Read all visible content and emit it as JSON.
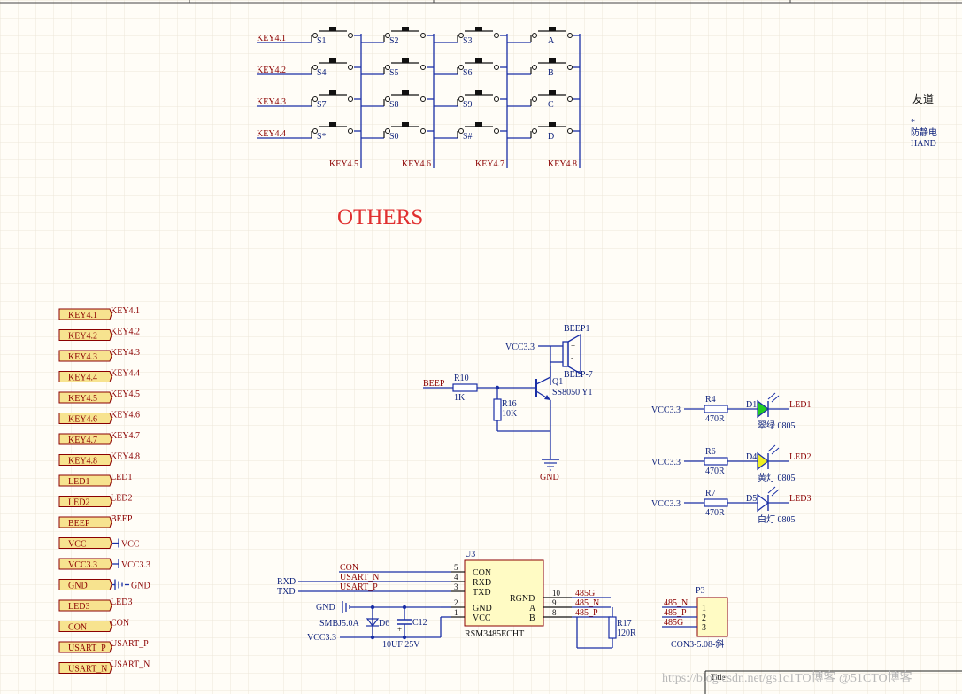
{
  "others_title": "OTHERS",
  "side_note": {
    "line1": "友道",
    "line2": "*",
    "line3": "防静电",
    "line4": "HAND"
  },
  "keypad": {
    "row_nets": [
      "KEY4.1",
      "KEY4.2",
      "KEY4.3",
      "KEY4.4"
    ],
    "col_nets": [
      "KEY4.5",
      "KEY4.6",
      "KEY4.7",
      "KEY4.8"
    ],
    "keys": [
      [
        "S1",
        "S2",
        "S3",
        "A"
      ],
      [
        "S4",
        "S5",
        "S6",
        "B"
      ],
      [
        "S7",
        "S8",
        "S9",
        "C"
      ],
      [
        "S*",
        "S0",
        "S#",
        "D"
      ]
    ]
  },
  "ports": [
    {
      "label": "KEY4.1",
      "net": "KEY4.1"
    },
    {
      "label": "KEY4.2",
      "net": "KEY4.2"
    },
    {
      "label": "KEY4.3",
      "net": "KEY4.3"
    },
    {
      "label": "KEY4.4",
      "net": "KEY4.4"
    },
    {
      "label": "KEY4.5",
      "net": "KEY4.5"
    },
    {
      "label": "KEY4.6",
      "net": "KEY4.6"
    },
    {
      "label": "KEY4.7",
      "net": "KEY4.7"
    },
    {
      "label": "KEY4.8",
      "net": "KEY4.8"
    },
    {
      "label": "LED1",
      "net": "LED1"
    },
    {
      "label": "LED2",
      "net": "LED2"
    },
    {
      "label": "BEEP",
      "net": "BEEP"
    },
    {
      "label": "VCC",
      "net": "VCC"
    },
    {
      "label": "VCC3.3",
      "net": "VCC3.3"
    },
    {
      "label": "GND",
      "net": "GND"
    },
    {
      "label": "LED3",
      "net": "LED3"
    },
    {
      "label": "CON",
      "net": "CON"
    },
    {
      "label": "USART_P",
      "net": "USART_P"
    },
    {
      "label": "USART_N",
      "net": "USART_N"
    }
  ],
  "beeper": {
    "vcc": "VCC3.3",
    "beep_ref": "BEEP1",
    "beep_val": "BEEP-7",
    "plus": "+",
    "minus": "-",
    "net": "BEEP",
    "r10_ref": "R10",
    "r10_val": "1K",
    "r16_ref": "R16",
    "r16_val": "10K",
    "q_ref": "Q1",
    "q_val": "SS8050 Y1",
    "gnd": "GND"
  },
  "leds": [
    {
      "vcc": "VCC3.3",
      "r_ref": "R4",
      "r_val": "470R",
      "d_ref": "D1",
      "d_val": "翠绿 0805",
      "net": "LED1",
      "color": "#22cc22"
    },
    {
      "vcc": "VCC3.3",
      "r_ref": "R6",
      "r_val": "470R",
      "d_ref": "D4",
      "d_val": "黄灯 0805",
      "net": "LED2",
      "color": "#eeee22"
    },
    {
      "vcc": "VCC3.3",
      "r_ref": "R7",
      "r_val": "470R",
      "d_ref": "D5",
      "d_val": "白灯 0805",
      "net": "LED3",
      "color": "#ffffff"
    }
  ],
  "rs485": {
    "ic_ref": "U3",
    "ic_val": "RSM3485ECHT",
    "left_pins": [
      {
        "num": "5",
        "name": "CON",
        "net": "CON"
      },
      {
        "num": "4",
        "name": "RXD",
        "net": "USART_N"
      },
      {
        "num": "3",
        "name": "TXD",
        "net": "USART_P"
      },
      {
        "num": "2",
        "name": "GND",
        "net": ""
      },
      {
        "num": "1",
        "name": "VCC",
        "net": ""
      }
    ],
    "right_pins": [
      {
        "num": "10",
        "name": "RGND",
        "net": "485G"
      },
      {
        "num": "9",
        "name": "A",
        "net": "485_N"
      },
      {
        "num": "8",
        "name": "B",
        "net": "485_P"
      }
    ],
    "rxd_net": "RXD",
    "txd_net": "TXD",
    "gnd": "GND",
    "tvs_ref": "D6",
    "tvs_val": "SMBJ5.0A",
    "cap_ref": "C12",
    "cap_val": "10UF 25V",
    "cap_plus": "+",
    "vcc": "VCC3.3",
    "r17_ref": "R17",
    "r17_val": "120R",
    "conn_ref": "P3",
    "conn_val": "CON3-5.08-斜",
    "conn_pins": [
      "1",
      "2",
      "3"
    ],
    "conn_nets": [
      "485_N",
      "485_P",
      "485G"
    ]
  },
  "title_block": {
    "label": "Title"
  },
  "watermark": "https://blog.csdn.net/gs1c1TO博客 @51CTO博客"
}
